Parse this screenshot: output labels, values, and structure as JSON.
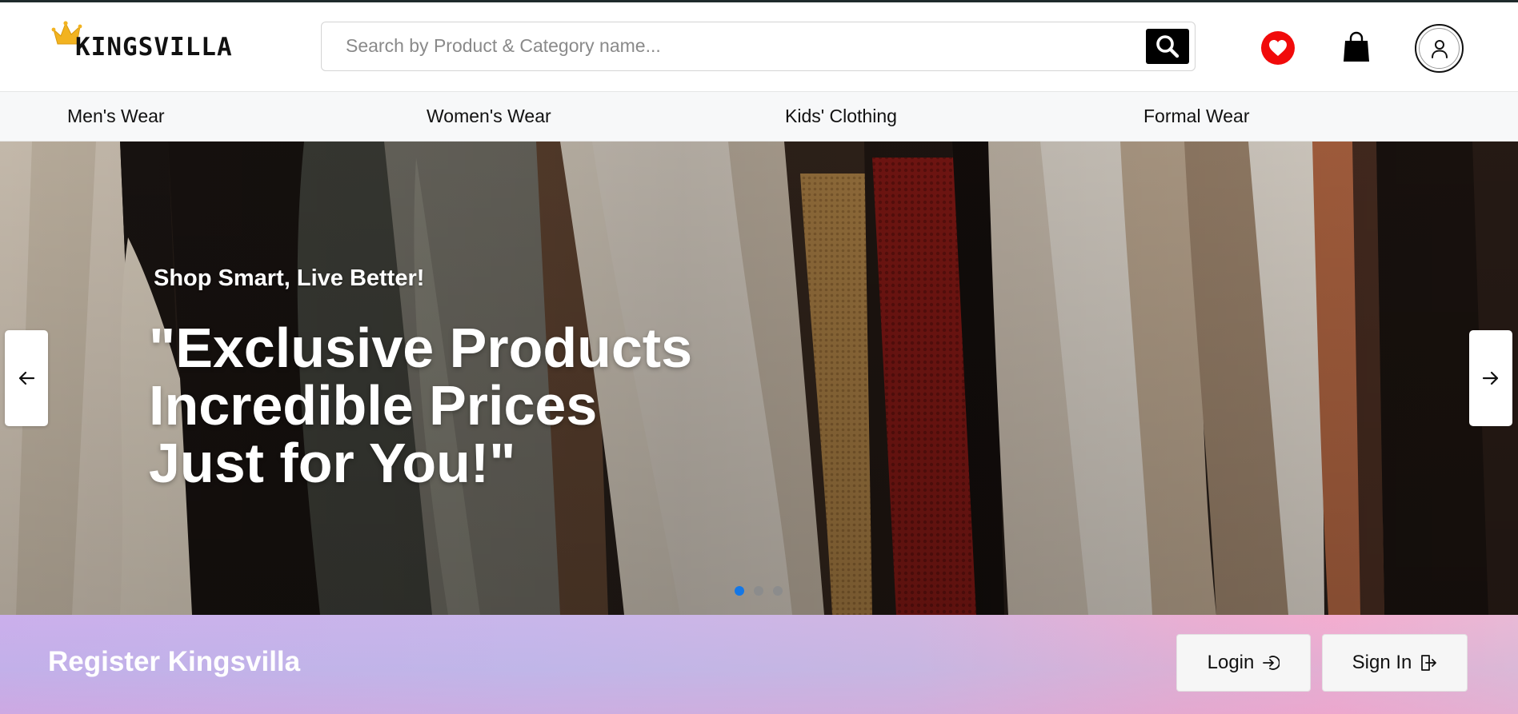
{
  "header": {
    "logo_text": "KINGSVILLA",
    "search": {
      "placeholder": "Search by Product & Category name..."
    }
  },
  "nav": {
    "items": [
      {
        "label": "Men's Wear"
      },
      {
        "label": "Women's Wear"
      },
      {
        "label": "Kids' Clothing"
      },
      {
        "label": "Formal Wear"
      }
    ]
  },
  "hero": {
    "subtitle": "Shop Smart, Live Better!",
    "title_lines": [
      "\"Exclusive Products",
      "Incredible Prices",
      "Just for You!\""
    ],
    "slide_count": 3,
    "active_slide": 1
  },
  "register": {
    "title": "Register Kingsvilla",
    "login_label": "Login",
    "signin_label": "Sign In"
  },
  "colors": {
    "wishlist": "#f10a0a",
    "active_dot": "#1477e6",
    "search_button": "#000000"
  },
  "icons": {
    "logo": "crown-icon",
    "search": "search-icon",
    "wishlist": "heart-icon",
    "cart": "shopping-bag-icon",
    "profile": "user-icon",
    "prev": "arrow-left-icon",
    "next": "arrow-right-icon",
    "login": "login-icon",
    "signin": "sign-in-icon"
  }
}
